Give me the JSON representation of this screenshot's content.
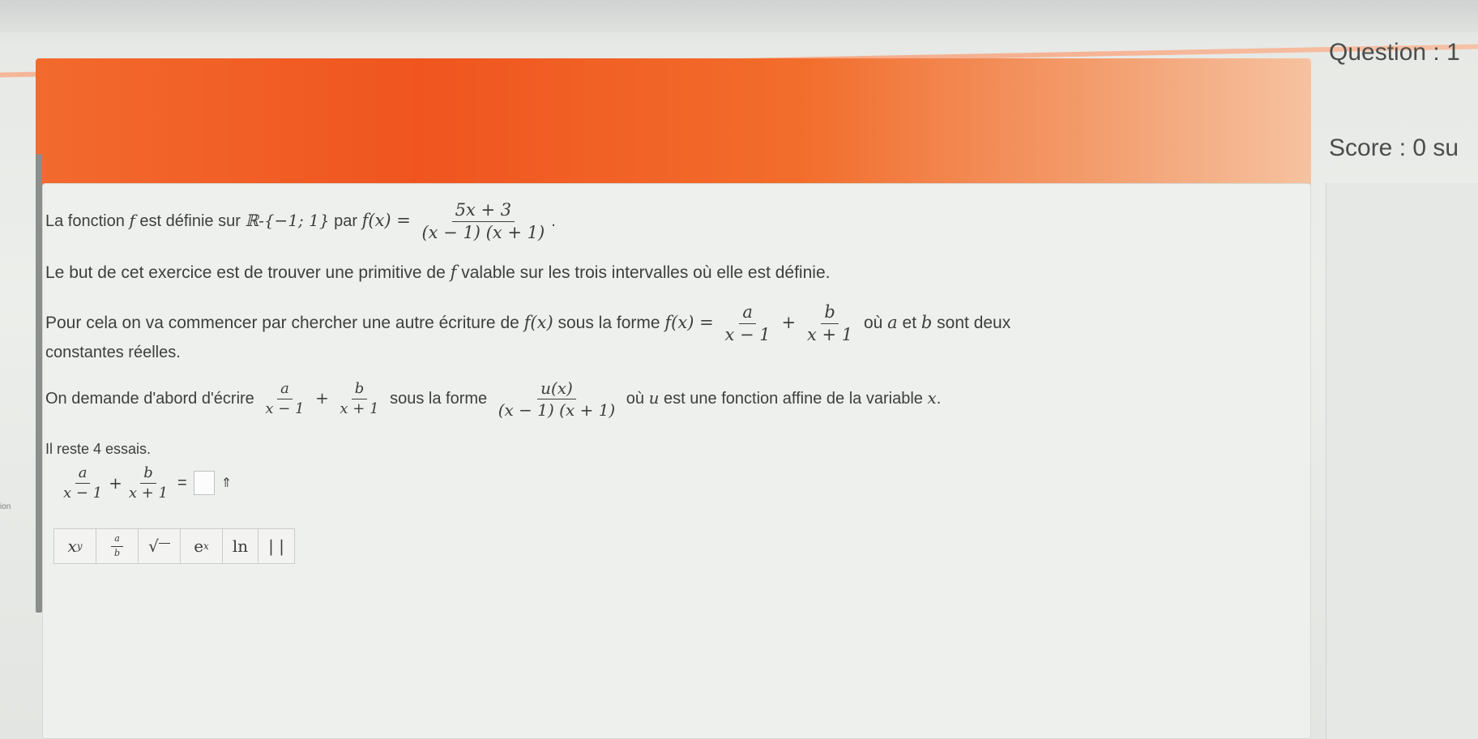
{
  "sidebar": {
    "question_label": "Question : 1",
    "score_label": "Score : 0 su"
  },
  "exercise": {
    "line1_pre": "La fonction ",
    "f": "f",
    "line1_mid": " est définie sur ",
    "domain": "ℝ-{−1; 1}",
    "line1_par": " par ",
    "fx": "f(x) =",
    "f_num": "5x + 3",
    "f_den": "(x − 1) (x + 1)",
    "line1_end": ".",
    "line2": "Le but de cet exercice est de trouver une primitive de ",
    "line2_end": " valable sur les trois intervalles où elle est définie.",
    "line3_pre": "Pour cela on va commencer par chercher une autre écriture de ",
    "line3_fx": "f(x)",
    "line3_mid": " sous la forme ",
    "line3_eq": "f(x) =",
    "frac_a_num": "a",
    "frac_a_den": "x − 1",
    "plus": "+",
    "frac_b_num": "b",
    "frac_b_den": "x + 1",
    "line3_where": " où ",
    "a": "a",
    "et": " et ",
    "b": "b",
    "line3_end": " sont deux",
    "line4": "constantes réelles.",
    "line5_pre": "On demande d'abord d'écrire ",
    "line5_mid": " sous la forme ",
    "u_num": "u(x)",
    "u_den": "(x − 1) (x + 1)",
    "line5_where": " où ",
    "u": "u",
    "line5_end": " est une fonction affine de la variable ",
    "x": "x",
    "dot": ".",
    "attempts": "Il reste 4 essais.",
    "answer_eq": "="
  },
  "answer": {
    "toggle_icon": "⇑"
  },
  "toolbar": {
    "buttons": [
      "x^y",
      "a/b",
      "√",
      "e^x",
      "ln",
      "| |"
    ],
    "power": "x",
    "power_sup": "y",
    "frac_top": "a",
    "frac_bot": "b",
    "sqrt": "√",
    "exp": "e",
    "exp_sup": "x",
    "ln": "ln",
    "abs": "| |"
  },
  "side": {
    "note": "ion"
  },
  "colors": {
    "banner": "#f0551f",
    "panel": "#eef0ed"
  }
}
